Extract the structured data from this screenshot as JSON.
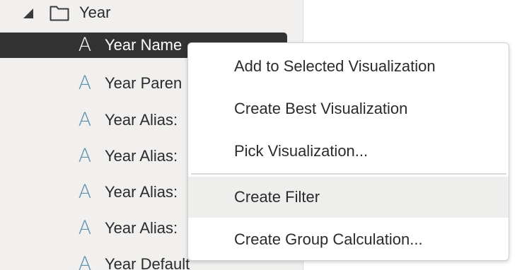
{
  "tree": {
    "folder": {
      "label": "Year",
      "expand_icon": "expanded-triangle-icon",
      "icon": "folder-icon"
    },
    "items": [
      {
        "label": "Year Name",
        "icon": "attribute-a-icon",
        "selected": true
      },
      {
        "label": "Year Paren",
        "icon": "attribute-a-icon",
        "selected": false
      },
      {
        "label": "Year Alias:",
        "icon": "attribute-a-icon",
        "selected": false
      },
      {
        "label": "Year Alias:",
        "icon": "attribute-a-icon",
        "selected": false
      },
      {
        "label": "Year Alias:",
        "icon": "attribute-a-icon",
        "selected": false
      },
      {
        "label": "Year Alias:",
        "icon": "attribute-a-icon",
        "selected": false
      },
      {
        "label": "Year Default",
        "icon": "attribute-a-icon",
        "selected": false
      }
    ],
    "attr_glyph": "A"
  },
  "context_menu": {
    "items": [
      {
        "label": "Add to Selected Visualization"
      },
      {
        "label": "Create Best Visualization"
      },
      {
        "label": "Pick Visualization..."
      },
      {
        "label": "Create Filter",
        "hovered": true
      },
      {
        "label": "Create Group Calculation..."
      }
    ]
  },
  "colors": {
    "panel_bg": "#f1f0ee",
    "selected_bg": "#333333",
    "attr_icon": "#5d8fb0",
    "menu_hover": "#eeeeec"
  }
}
